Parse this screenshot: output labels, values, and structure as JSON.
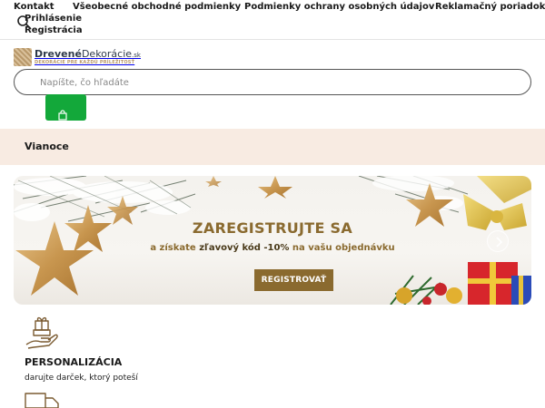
{
  "top_links": {
    "kontakt": "Kontakt",
    "obchodne_podmienky": "Všeobecné obchodné podmienky",
    "ochrana_udajov": "Podmienky ochrany osobných údajov",
    "reklamacny_poriadok": "Reklamačný poriadok",
    "prihlasenie": "Prihlásenie",
    "registracia": "Registrácia"
  },
  "logo": {
    "title_bold": "Drevené",
    "title_light": "Dekorácie",
    "title_suffix": ".sk",
    "tagline": "DEKORÁCIE PRE KAŽDÚ PRÍLEŽITOSŤ"
  },
  "search": {
    "placeholder": "Napíšte, čo hľadáte",
    "value": ""
  },
  "category_nav": {
    "item": "Vianoce"
  },
  "banner": {
    "title": "ZAREGISTRUJTE SA",
    "subtitle_pre": "a získate ",
    "subtitle_highlight": "zľavový kód -10%",
    "subtitle_post": " na vašu objednávku",
    "button_label": "REGISTROVAŤ"
  },
  "features": [
    {
      "icon": "gift-hand-icon",
      "title": "PERSONALIZÁCIA",
      "desc": "darujte darček, ktorý poteší"
    },
    {
      "icon": "delivery-truck-icon"
    }
  ],
  "colors": {
    "accent_green": "#13a83a",
    "category_bg": "#f8ebe2",
    "banner_gold": "#8a6a2f"
  }
}
